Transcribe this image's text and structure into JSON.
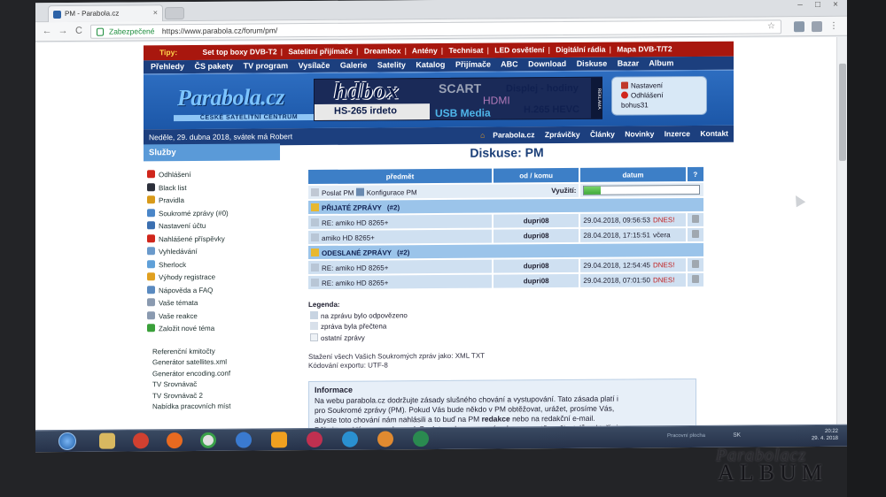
{
  "browser": {
    "tab_title": "PM - Parabola.cz",
    "tab_close": "×",
    "secure_label": "Zabezpečené",
    "url": "https://www.parabola.cz/forum/pm/",
    "back": "←",
    "forward": "→",
    "reload": "C",
    "star": "☆",
    "minimize": "–",
    "maximize": "□",
    "close": "×"
  },
  "site": {
    "tips_label": "Tipy:",
    "tips": [
      "Set top boxy DVB-T2",
      "Satelitní přijímače",
      "Dreambox",
      "Antény",
      "Technisat",
      "LED osvětlení",
      "Digitální rádia",
      "Mapa DVB-T/T2"
    ],
    "tips_sep": "|",
    "nav": [
      "Přehledy",
      "ČS pakety",
      "TV program",
      "Vysílače",
      "Galerie",
      "Satelity",
      "Katalog",
      "Přijímače",
      "ABC",
      "Download",
      "Diskuse",
      "Bazar",
      "Album"
    ],
    "logo": "Parabola.cz",
    "logo_sub": "ČESKÉ SATELITNÍ CENTRUM",
    "ad": {
      "brand": "hdbox",
      "model": "HS-265 irdeto",
      "scart": "SCART",
      "hdmi": "HDMI",
      "usb": "USB Media",
      "display": "Displej - hodiny",
      "codec": "H.265 HEVC",
      "reklama": "REKLAMA"
    },
    "user": {
      "settings": "Nastavení",
      "logout": "Odhlášení",
      "name": "bohus31"
    },
    "date": "Neděle, 29. dubna 2018, svátek má Robert",
    "top_links": [
      "Parabola.cz",
      "Zprávičky",
      "Články",
      "Novinky",
      "Inzerce",
      "Kontakt"
    ]
  },
  "sidebar": {
    "title": "Služby",
    "items": [
      {
        "label": "Odhlášení",
        "color": "#d0261c"
      },
      {
        "label": "Black list",
        "color": "#2b2f3a"
      },
      {
        "label": "Pravidla",
        "color": "#d89a1a"
      },
      {
        "label": "Soukromé zprávy (#0)",
        "color": "#4a86c8"
      },
      {
        "label": "Nastavení účtu",
        "color": "#3a6fb0"
      },
      {
        "label": "Nahlášené příspěvky",
        "color": "#d0261c"
      },
      {
        "label": "Vyhledávání",
        "color": "#6a9acb"
      },
      {
        "label": "Sherlock",
        "color": "#5fa0d8"
      },
      {
        "label": "Výhody registrace",
        "color": "#e0a020"
      },
      {
        "label": "Nápověda a FAQ",
        "color": "#5a8ac0"
      },
      {
        "label": "Vaše témata",
        "color": "#8a9ab0"
      },
      {
        "label": "Vaše reakce",
        "color": "#8a9ab0"
      },
      {
        "label": "Založit nové téma",
        "color": "#3aa03a"
      }
    ],
    "extra": [
      "Referenční kmitočty",
      "Generátor satellites.xml",
      "Generátor encoding.conf",
      "TV Srovnávač",
      "TV Srovnávač 2",
      "Nabídka pracovních míst"
    ]
  },
  "main": {
    "title": "Diskuse: PM",
    "headers": {
      "subject": "předmět",
      "from_to": "od / komu",
      "date": "datum",
      "help": "?"
    },
    "send_pm": "Poslat PM",
    "config_pm": "Konfigurace PM",
    "usage_label": "Využití:",
    "usage_fraction": 0.14,
    "folders": [
      {
        "name": "PŘIJATÉ ZPRÁVY",
        "count": "(#2)",
        "messages": [
          {
            "subject": "RE: amiko HD 8265+",
            "user": "dupri08",
            "date": "29.04.2018, 09:56:53",
            "when": "DNES!"
          },
          {
            "subject": "amiko HD 8265+",
            "user": "dupri08",
            "date": "28.04.2018, 17:15:51",
            "when": "včera"
          }
        ]
      },
      {
        "name": "ODESLANÉ ZPRÁVY",
        "count": "(#2)",
        "messages": [
          {
            "subject": "RE: amiko HD 8265+",
            "user": "dupri08",
            "date": "29.04.2018, 12:54:45",
            "when": "DNES!"
          },
          {
            "subject": "RE: amiko HD 8265+",
            "user": "dupri08",
            "date": "29.04.2018, 07:01:50",
            "when": "DNES!"
          }
        ]
      }
    ],
    "legend": {
      "title": "Legenda:",
      "items": [
        "na zprávu bylo odpovězeno",
        "zpráva byla přečtena",
        "ostatní zprávy"
      ]
    },
    "exports": {
      "line1": "Stažení všech Vašich Soukromých zpráv jako: XML TXT",
      "line2": "Kódování exportu: UTF-8"
    },
    "info": {
      "title": "Informace",
      "line1": "Na webu parabola.cz dodržujte zásady slušného chování a vystupování. Tato zásada platí i",
      "line2": "pro Soukromé zprávy (PM). Pokud Vás bude někdo v PM obtěžovat, urážet, prosíme Vás,",
      "line3": "abyste toto chování nám nahlásili a to buď na PM ",
      "line3_bold": "redakce",
      "line3_end": " nebo na redakční e-mail.",
      "line4": "Děkujeme. Vám za pochopení. Poslat soukromou zprávu lze pouze těm uživatelům, kteří si"
    }
  },
  "taskbar": {
    "tray_net": "Pracovní plocha",
    "lang": "SK",
    "time": "20:22",
    "date": "29. 4. 2018"
  },
  "watermark": {
    "line1": "Parabolacz",
    "line2": "ALBUM"
  }
}
